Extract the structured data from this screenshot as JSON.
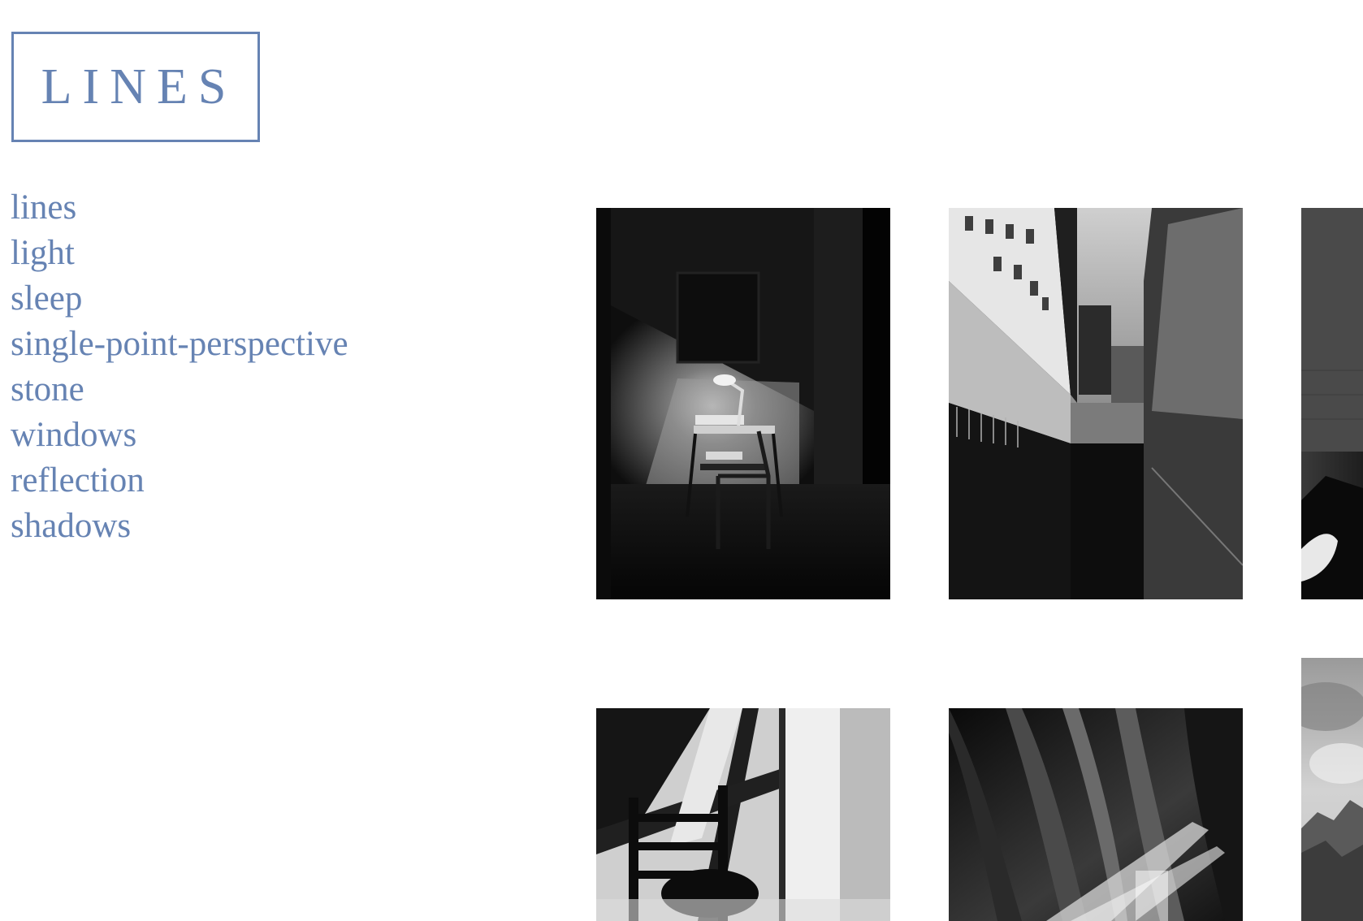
{
  "site": {
    "logo_text": "LINES",
    "accent_color": "#6683b3"
  },
  "nav": {
    "items": [
      {
        "label": "lines"
      },
      {
        "label": "light"
      },
      {
        "label": "sleep"
      },
      {
        "label": "single-point-perspective"
      },
      {
        "label": "stone"
      },
      {
        "label": "windows"
      },
      {
        "label": "reflection"
      },
      {
        "label": "shadows"
      }
    ]
  },
  "gallery": {
    "photos": [
      {
        "subject": "desk lamp lighting a chair and small desk in a dark room"
      },
      {
        "subject": "alley between tall buildings looking up at the sky"
      },
      {
        "subject": "partial photo cropped at the right edge"
      },
      {
        "subject": "window shadow falling over a wooden chair"
      },
      {
        "subject": "sheer curtains with light shining through"
      },
      {
        "subject": "mountains under a cloudy sky cropped at the right edge"
      }
    ]
  }
}
